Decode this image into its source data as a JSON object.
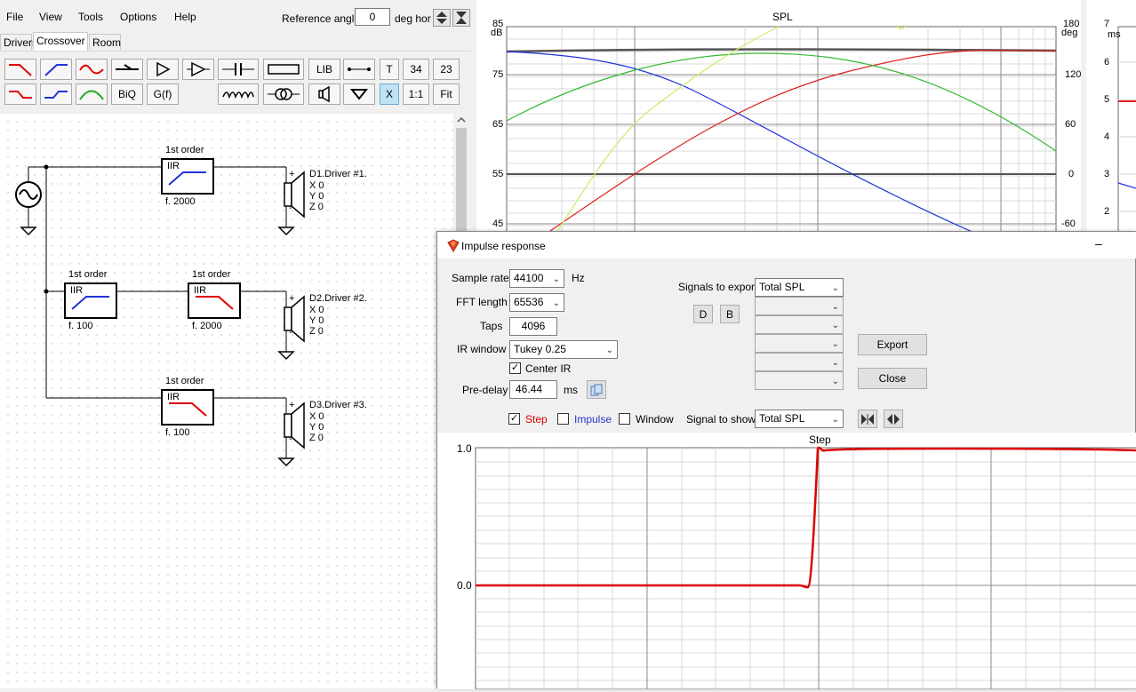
{
  "menu": {
    "file": "File",
    "view": "View",
    "tools": "Tools",
    "options": "Options",
    "help": "Help"
  },
  "reference": {
    "label": "Reference angle",
    "value": "0",
    "unit": "deg hor"
  },
  "tabs": [
    "Drivers",
    "Crossover",
    "Room"
  ],
  "toolbar": {
    "lib": "LIB",
    "t": "T",
    "n34": "34",
    "n23": "23",
    "biq": "BiQ",
    "gf": "G(f)",
    "x": "X",
    "ratio": "1:1",
    "fit": "Fit"
  },
  "schematic": {
    "blocks": [
      {
        "order": "1st order",
        "type": "IIR",
        "freq": "f. 2000"
      },
      {
        "order": "1st order",
        "type": "IIR",
        "freq": "f. 100"
      },
      {
        "order": "1st order",
        "type": "IIR",
        "freq": "f. 2000"
      },
      {
        "order": "1st order",
        "type": "IIR",
        "freq": "f. 100"
      }
    ],
    "drivers": [
      {
        "name": "D1.Driver #1.",
        "x": "X 0",
        "y": "Y 0",
        "z": "Z 0"
      },
      {
        "name": "D2.Driver #2.",
        "x": "X 0",
        "y": "Y 0",
        "z": "Z 0"
      },
      {
        "name": "D3.Driver #3.",
        "x": "X 0",
        "y": "Y 0",
        "z": "Z 0"
      }
    ],
    "plus": "+",
    "minus": "-"
  },
  "spl": {
    "title": "SPL",
    "left_unit": "dB",
    "right_unit": "deg",
    "left_ticks": [
      "85",
      "75",
      "65",
      "55",
      "45"
    ],
    "right_ticks": [
      "180",
      "120",
      "60",
      "0",
      "-60"
    ]
  },
  "side": {
    "unit": "ms",
    "ticks": [
      "7",
      "6",
      "5",
      "4",
      "3",
      "2"
    ]
  },
  "dialog": {
    "title": "Impulse response",
    "minimize": "–",
    "sample_rate": {
      "label": "Sample rate",
      "value": "44100",
      "unit": "Hz"
    },
    "fft_length": {
      "label": "FFT length",
      "value": "65536"
    },
    "taps": {
      "label": "Taps",
      "value": "4096"
    },
    "ir_window": {
      "label": "IR window",
      "value": "Tukey 0.25"
    },
    "center_ir": {
      "label": "Center IR",
      "checked": "✓"
    },
    "pre_delay": {
      "label": "Pre-delay",
      "value": "46.44",
      "unit": "ms"
    },
    "signals_to_export": {
      "label": "Signals to export",
      "first": "Total SPL",
      "d": "D",
      "b": "B"
    },
    "export": "Export",
    "close": "Close",
    "step": {
      "label": "Step",
      "checked": "✓"
    },
    "impulse": {
      "label": "Impulse"
    },
    "window": {
      "label": "Window"
    },
    "signal_to_show": {
      "label": "Signal to show",
      "value": "Total SPL"
    },
    "plot": {
      "title": "Step",
      "y_top": "1.0",
      "y_zero": "0.0"
    }
  },
  "colors": {
    "step": "#dd0000",
    "blue": "#2233dd",
    "red": "#e02020",
    "green": "#33bb33",
    "lime": "#c8ee66",
    "selected": "#bfe3f5"
  }
}
